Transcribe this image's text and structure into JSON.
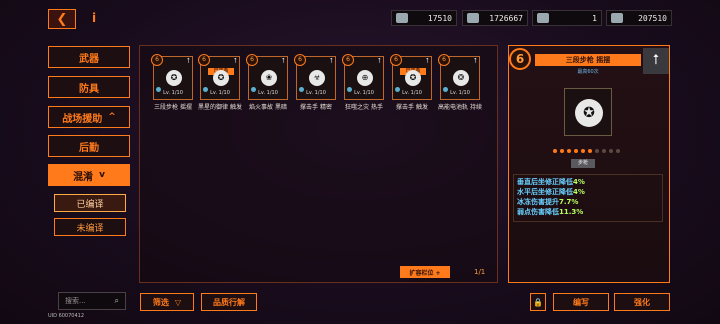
{
  "topbar": {
    "back_icon": "back-arrow-icon",
    "info_icon": "info-icon",
    "currencies": [
      {
        "icon": "cube-icon",
        "value": "17510"
      },
      {
        "icon": "ticket-icon",
        "value": "1726667"
      },
      {
        "icon": "bullet-icon",
        "value": "1"
      },
      {
        "icon": "gem-icon",
        "value": "207510"
      }
    ]
  },
  "sidebar": {
    "items": [
      {
        "label": "武器"
      },
      {
        "label": "防具"
      },
      {
        "label": "战场援助",
        "chevron": "^"
      },
      {
        "label": "后勤"
      },
      {
        "label": "混淆",
        "chevron": "v"
      }
    ],
    "sub_items": [
      {
        "label": "已编译"
      },
      {
        "label": "未编译"
      }
    ]
  },
  "cards": [
    {
      "level_badge": "6",
      "emblem": "✪",
      "tag": "",
      "lv": "Lv. 1/10",
      "name": "三段步枪 摇摆"
    },
    {
      "level_badge": "6",
      "emblem": "✪",
      "tag": "已装备",
      "lv": "Lv. 1/10",
      "name": "黑星的御律 触发"
    },
    {
      "level_badge": "6",
      "emblem": "❀",
      "tag": "",
      "lv": "Lv. 1/10",
      "name": "焰火事故 黑暗"
    },
    {
      "level_badge": "6",
      "emblem": "☣",
      "tag": "",
      "lv": "Lv. 1/10",
      "name": "撑击手 精密"
    },
    {
      "level_badge": "6",
      "emblem": "⊕",
      "tag": "",
      "lv": "Lv. 1/10",
      "name": "狂嗤之灾 热手"
    },
    {
      "level_badge": "6",
      "emblem": "✪",
      "tag": "已装备",
      "lv": "Lv. 1/10",
      "name": "撑击手 触发"
    },
    {
      "level_badge": "6",
      "emblem": "❂",
      "tag": "",
      "lv": "Lv. 1/10",
      "name": "高能电池轨 持续"
    }
  ],
  "main": {
    "expand_label": "扩容栏位 +",
    "page_indicator": "1/1"
  },
  "detail": {
    "level": "6",
    "title": "三段步枪 摇摆",
    "subtitle": "最高60次",
    "up_icon": "arrow-up-icon",
    "emblem": "✪",
    "type": "步枪",
    "stats": [
      {
        "text": "垂直后坐修正降低",
        "value": "4%"
      },
      {
        "text": "水平后坐修正降低",
        "value": "4%"
      },
      {
        "text": "冰冻伤害提升",
        "value": "7.7%"
      },
      {
        "text": "弱点伤害降低",
        "value": "11.3%"
      }
    ]
  },
  "bottom": {
    "search_placeholder": "搜索...",
    "uid": "UID 60070412",
    "filter_label": "筛选",
    "sort_label": "品质行解",
    "lock_icon": "lock-icon",
    "compile_label": "编写",
    "enhance_label": "强化"
  }
}
